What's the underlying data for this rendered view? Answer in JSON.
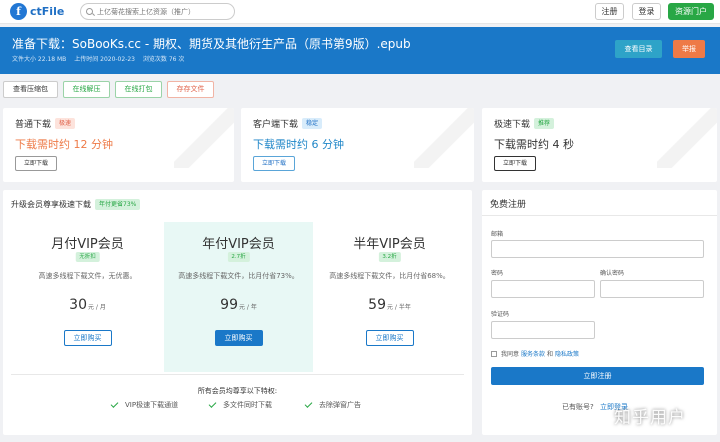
{
  "nav": {
    "logo_text": "ctFile",
    "logo_mark": "f",
    "search_placeholder": "上亿菊花搜索上亿资源（推广）",
    "register": "注册",
    "login": "登录",
    "portal": "资源门户"
  },
  "file": {
    "title": "准备下载：SoBooKs.cc - 期权、期货及其他衍生产品（原书第9版）.epub",
    "size": "文件大小 22.18 MB",
    "upload_time": "上传时间 2020-02-23",
    "views": "浏览次数 76 次",
    "view_directory": "查看目录",
    "report": "举报"
  },
  "tools": [
    "查看压缩包",
    "在线解压",
    "在线打包",
    "存存文件"
  ],
  "downloads": [
    {
      "title": "普通下载",
      "badge": "极速",
      "time": "下载需时约 12 分钟",
      "button": "立即下载"
    },
    {
      "title": "客户端下载",
      "badge": "稳定",
      "time": "下载需时约 6 分钟",
      "button": "立即下载"
    },
    {
      "title": "极速下载",
      "badge": "推荐",
      "time": "下载需时约 4 秒",
      "button": "立即下载"
    }
  ],
  "vip": {
    "title": "升级会员尊享极速下载",
    "title_badge": "年付更省73%",
    "plans": [
      {
        "name": "月付VIP会员",
        "badge": "无折扣",
        "desc": "高速多线程下载文件，无优惠。",
        "price": "30",
        "unit": "元 / 月",
        "button": "立即购买"
      },
      {
        "name": "年付VIP会员",
        "badge": "2.7折",
        "desc": "高速多线程下载文件，比月付省73%。",
        "price": "99",
        "unit": "元 / 年",
        "button": "立即购买"
      },
      {
        "name": "半年VIP会员",
        "badge": "3.2折",
        "desc": "高速多线程下载文件，比月付省68%。",
        "price": "59",
        "unit": "元 / 半年",
        "button": "立即购买"
      }
    ],
    "features_title": "所有会员均尊享以下特权:",
    "features": [
      "VIP极速下载通道",
      "多文件同时下载",
      "去除弹窗广告"
    ]
  },
  "register": {
    "title": "免费注册",
    "email_label": "邮箱",
    "password_label": "密码",
    "confirm_label": "确认密码",
    "captcha_label": "验证码",
    "agree_prefix": "我同意",
    "terms": "服务条款",
    "and": "和",
    "privacy": "隐私政策",
    "submit": "立即注册",
    "have_account": "已有账号?",
    "login_link": "立即登录"
  },
  "watermark": "知乎用户"
}
